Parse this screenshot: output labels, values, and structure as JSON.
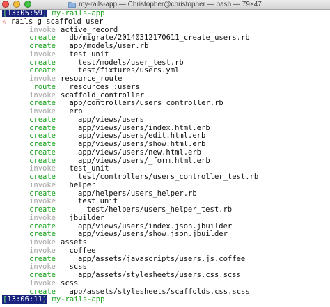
{
  "window": {
    "title": "my-rails-app — Christopher@christopher — bash — 79×47"
  },
  "prompt_start": {
    "time": "13:05:59",
    "host": "my-rails-app"
  },
  "command": {
    "marker": "☆",
    "text": "rails g scaffold user"
  },
  "output": [
    {
      "verb": "invoke",
      "indent": 0,
      "text": "active_record"
    },
    {
      "verb": "create",
      "indent": 1,
      "text": "db/migrate/20140312170611_create_users.rb"
    },
    {
      "verb": "create",
      "indent": 1,
      "text": "app/models/user.rb"
    },
    {
      "verb": "invoke",
      "indent": 1,
      "text": "test_unit"
    },
    {
      "verb": "create",
      "indent": 2,
      "text": "test/models/user_test.rb"
    },
    {
      "verb": "create",
      "indent": 2,
      "text": "test/fixtures/users.yml"
    },
    {
      "verb": "invoke",
      "indent": 0,
      "text": "resource_route"
    },
    {
      "verb": "route",
      "indent": 1,
      "text": "resources :users"
    },
    {
      "verb": "invoke",
      "indent": 0,
      "text": "scaffold_controller"
    },
    {
      "verb": "create",
      "indent": 1,
      "text": "app/controllers/users_controller.rb"
    },
    {
      "verb": "invoke",
      "indent": 1,
      "text": "erb"
    },
    {
      "verb": "create",
      "indent": 2,
      "text": "app/views/users"
    },
    {
      "verb": "create",
      "indent": 2,
      "text": "app/views/users/index.html.erb"
    },
    {
      "verb": "create",
      "indent": 2,
      "text": "app/views/users/edit.html.erb"
    },
    {
      "verb": "create",
      "indent": 2,
      "text": "app/views/users/show.html.erb"
    },
    {
      "verb": "create",
      "indent": 2,
      "text": "app/views/users/new.html.erb"
    },
    {
      "verb": "create",
      "indent": 2,
      "text": "app/views/users/_form.html.erb"
    },
    {
      "verb": "invoke",
      "indent": 1,
      "text": "test_unit"
    },
    {
      "verb": "create",
      "indent": 2,
      "text": "test/controllers/users_controller_test.rb"
    },
    {
      "verb": "invoke",
      "indent": 1,
      "text": "helper"
    },
    {
      "verb": "create",
      "indent": 2,
      "text": "app/helpers/users_helper.rb"
    },
    {
      "verb": "invoke",
      "indent": 2,
      "text": "test_unit"
    },
    {
      "verb": "create",
      "indent": 3,
      "text": "test/helpers/users_helper_test.rb"
    },
    {
      "verb": "invoke",
      "indent": 1,
      "text": "jbuilder"
    },
    {
      "verb": "create",
      "indent": 2,
      "text": "app/views/users/index.json.jbuilder"
    },
    {
      "verb": "create",
      "indent": 2,
      "text": "app/views/users/show.json.jbuilder"
    },
    {
      "verb": "invoke",
      "indent": 0,
      "text": "assets"
    },
    {
      "verb": "invoke",
      "indent": 1,
      "text": "coffee"
    },
    {
      "verb": "create",
      "indent": 2,
      "text": "app/assets/javascripts/users.js.coffee"
    },
    {
      "verb": "invoke",
      "indent": 1,
      "text": "scss"
    },
    {
      "verb": "create",
      "indent": 2,
      "text": "app/assets/stylesheets/users.css.scss"
    },
    {
      "verb": "invoke",
      "indent": 0,
      "text": "scss"
    },
    {
      "verb": "create",
      "indent": 1,
      "text": "app/assets/stylesheets/scaffolds.css.scss"
    }
  ],
  "prompt_end": {
    "time": "13:06:11",
    "host": "my-rails-app"
  },
  "colors": {
    "invoke": "#a5a5a5",
    "create": "#16a31a",
    "host": "#16a31a",
    "time_bg": "#1a237e"
  },
  "icons": {
    "window_folder": "folder-icon"
  }
}
